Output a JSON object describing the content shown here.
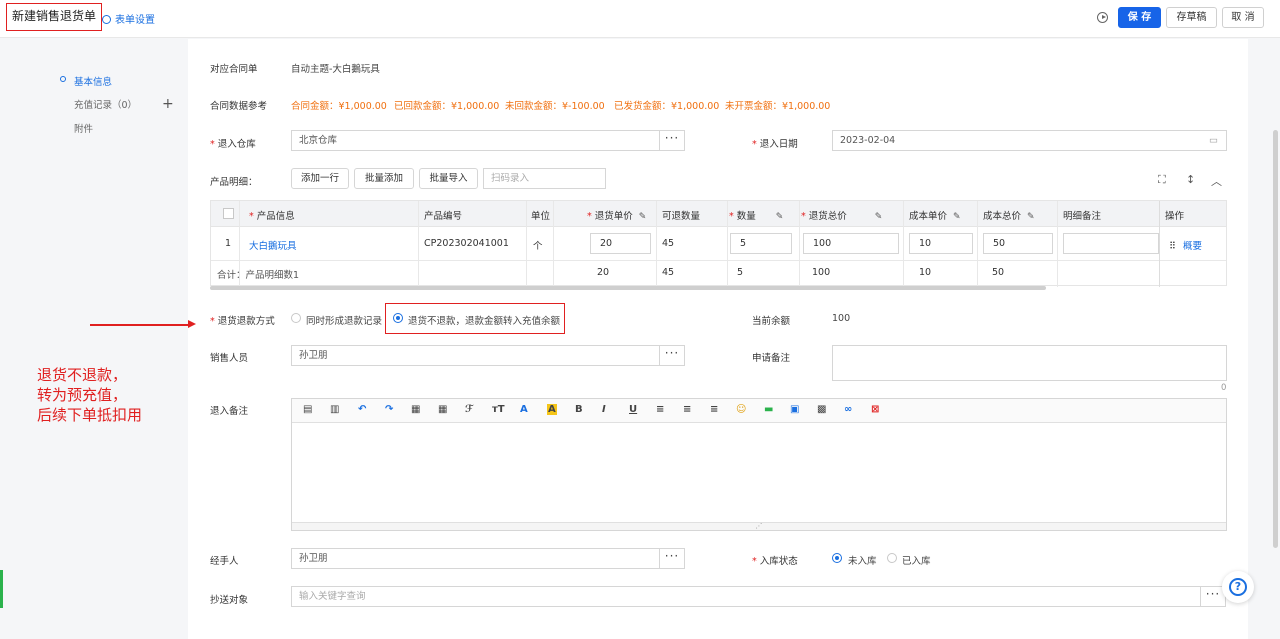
{
  "header": {
    "title": "新建销售退货单",
    "form_settings": "表单设置",
    "save": "保 存",
    "draft": "存草稿",
    "cancel": "取 消"
  },
  "nav": {
    "items": [
      {
        "label": "基本信息"
      },
      {
        "label": "充值记录（0）"
      },
      {
        "label": "附件"
      }
    ]
  },
  "form": {
    "contract_label": "对应合同单",
    "contract_value": "自动主题-大白鵝玩具",
    "reference_label": "合同数据参考",
    "reference": {
      "contract_amount": "合同金额：¥1,000.00",
      "received_amount": "已回款金额：¥1,000.00",
      "unreceived_amount": "未回款金额：¥-100.00",
      "shipped_amount": "已发货金额：¥1,000.00",
      "uninvoiced_amount": "未开票金额：¥1,000.00"
    },
    "warehouse_label": "退入仓库",
    "warehouse_value": "北京仓库",
    "date_label": "退入日期",
    "date_value": "2023-02-04",
    "products_label": "产品明细：",
    "add_row": "添加一行",
    "batch_add": "批量添加",
    "batch_import": "批量导入",
    "scan_placeholder": "扫码录入",
    "refund_method_label": "退货退款方式",
    "refund_option_1": "同时形成退款记录",
    "refund_option_2": "退货不退款，退款金额转入充值余额",
    "balance_label": "当前余额",
    "balance_value": "100",
    "salesperson_label": "销售人员",
    "salesperson_value": "孙卫朋",
    "apply_note_label": "申请备注",
    "apply_note_count": "0",
    "return_note_label": "退入备注",
    "handler_label": "经手人",
    "handler_value": "孙卫朋",
    "stock_status_label": "入库状态",
    "stock_option_1": "未入库",
    "stock_option_2": "已入库",
    "cc_label": "抄送对象",
    "cc_placeholder": "输入关键字查询",
    "ellipsis": "···"
  },
  "table": {
    "headers": {
      "product_info": "产品信息",
      "product_code": "产品编号",
      "unit": "单位",
      "return_price": "退货单价",
      "returnable_qty": "可退数量",
      "qty": "数量",
      "return_total": "退货总价",
      "cost_price": "成本单价",
      "cost_total": "成本总价",
      "detail_note": "明细备注",
      "ops": "操作"
    },
    "row": {
      "index": "1",
      "product": "大白鵝玩具",
      "code": "CP202302041001",
      "unit": "个",
      "price": "20",
      "returnable": "45",
      "qty": "5",
      "total": "100",
      "cost_price": "10",
      "cost_total": "50",
      "op": "概要"
    },
    "summary": {
      "label": "合计：产品明细数1",
      "price": "20",
      "returnable": "45",
      "qty": "5",
      "total": "100",
      "cost_price": "10",
      "cost_total": "50"
    }
  },
  "annotation": {
    "line1": "退货不退款，",
    "line2": "转为预充值，",
    "line3": "后续下单抵扣用"
  },
  "icons": {
    "accent": "#1a6fe0",
    "highlight": "#e02020",
    "orange": "#f07010"
  }
}
